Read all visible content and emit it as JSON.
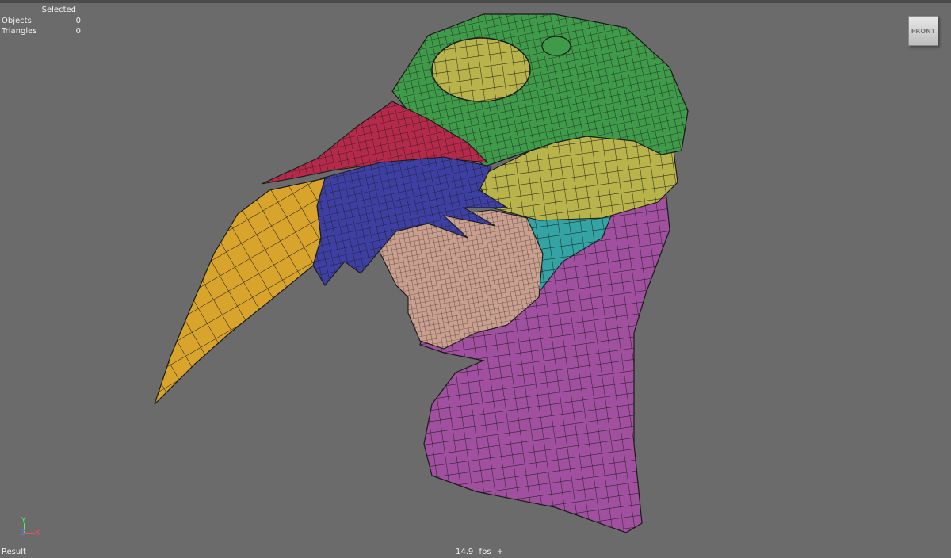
{
  "hud": {
    "selected_label": "Selected",
    "rows": [
      {
        "label": "Objects",
        "value": "0"
      },
      {
        "label": "Triangles",
        "value": "0"
      }
    ]
  },
  "viewcube": {
    "label": "FRONT"
  },
  "axes": {
    "y": "Y",
    "z": "Z",
    "x": "X"
  },
  "status": {
    "left": "Result",
    "fps": "14.9  fps  +"
  },
  "colors": {
    "background": "#6b6b6b",
    "beak": "#d9a42c",
    "red_mask": "#b52a4a",
    "blue_feathers": "#3e3fa3",
    "face": "#c9a090",
    "green_cap": "#3f9a4a",
    "yellow_band": "#b8b34a",
    "teal": "#33a3a3",
    "purple_collar": "#a0509f",
    "wire": "#1a1a1a"
  }
}
